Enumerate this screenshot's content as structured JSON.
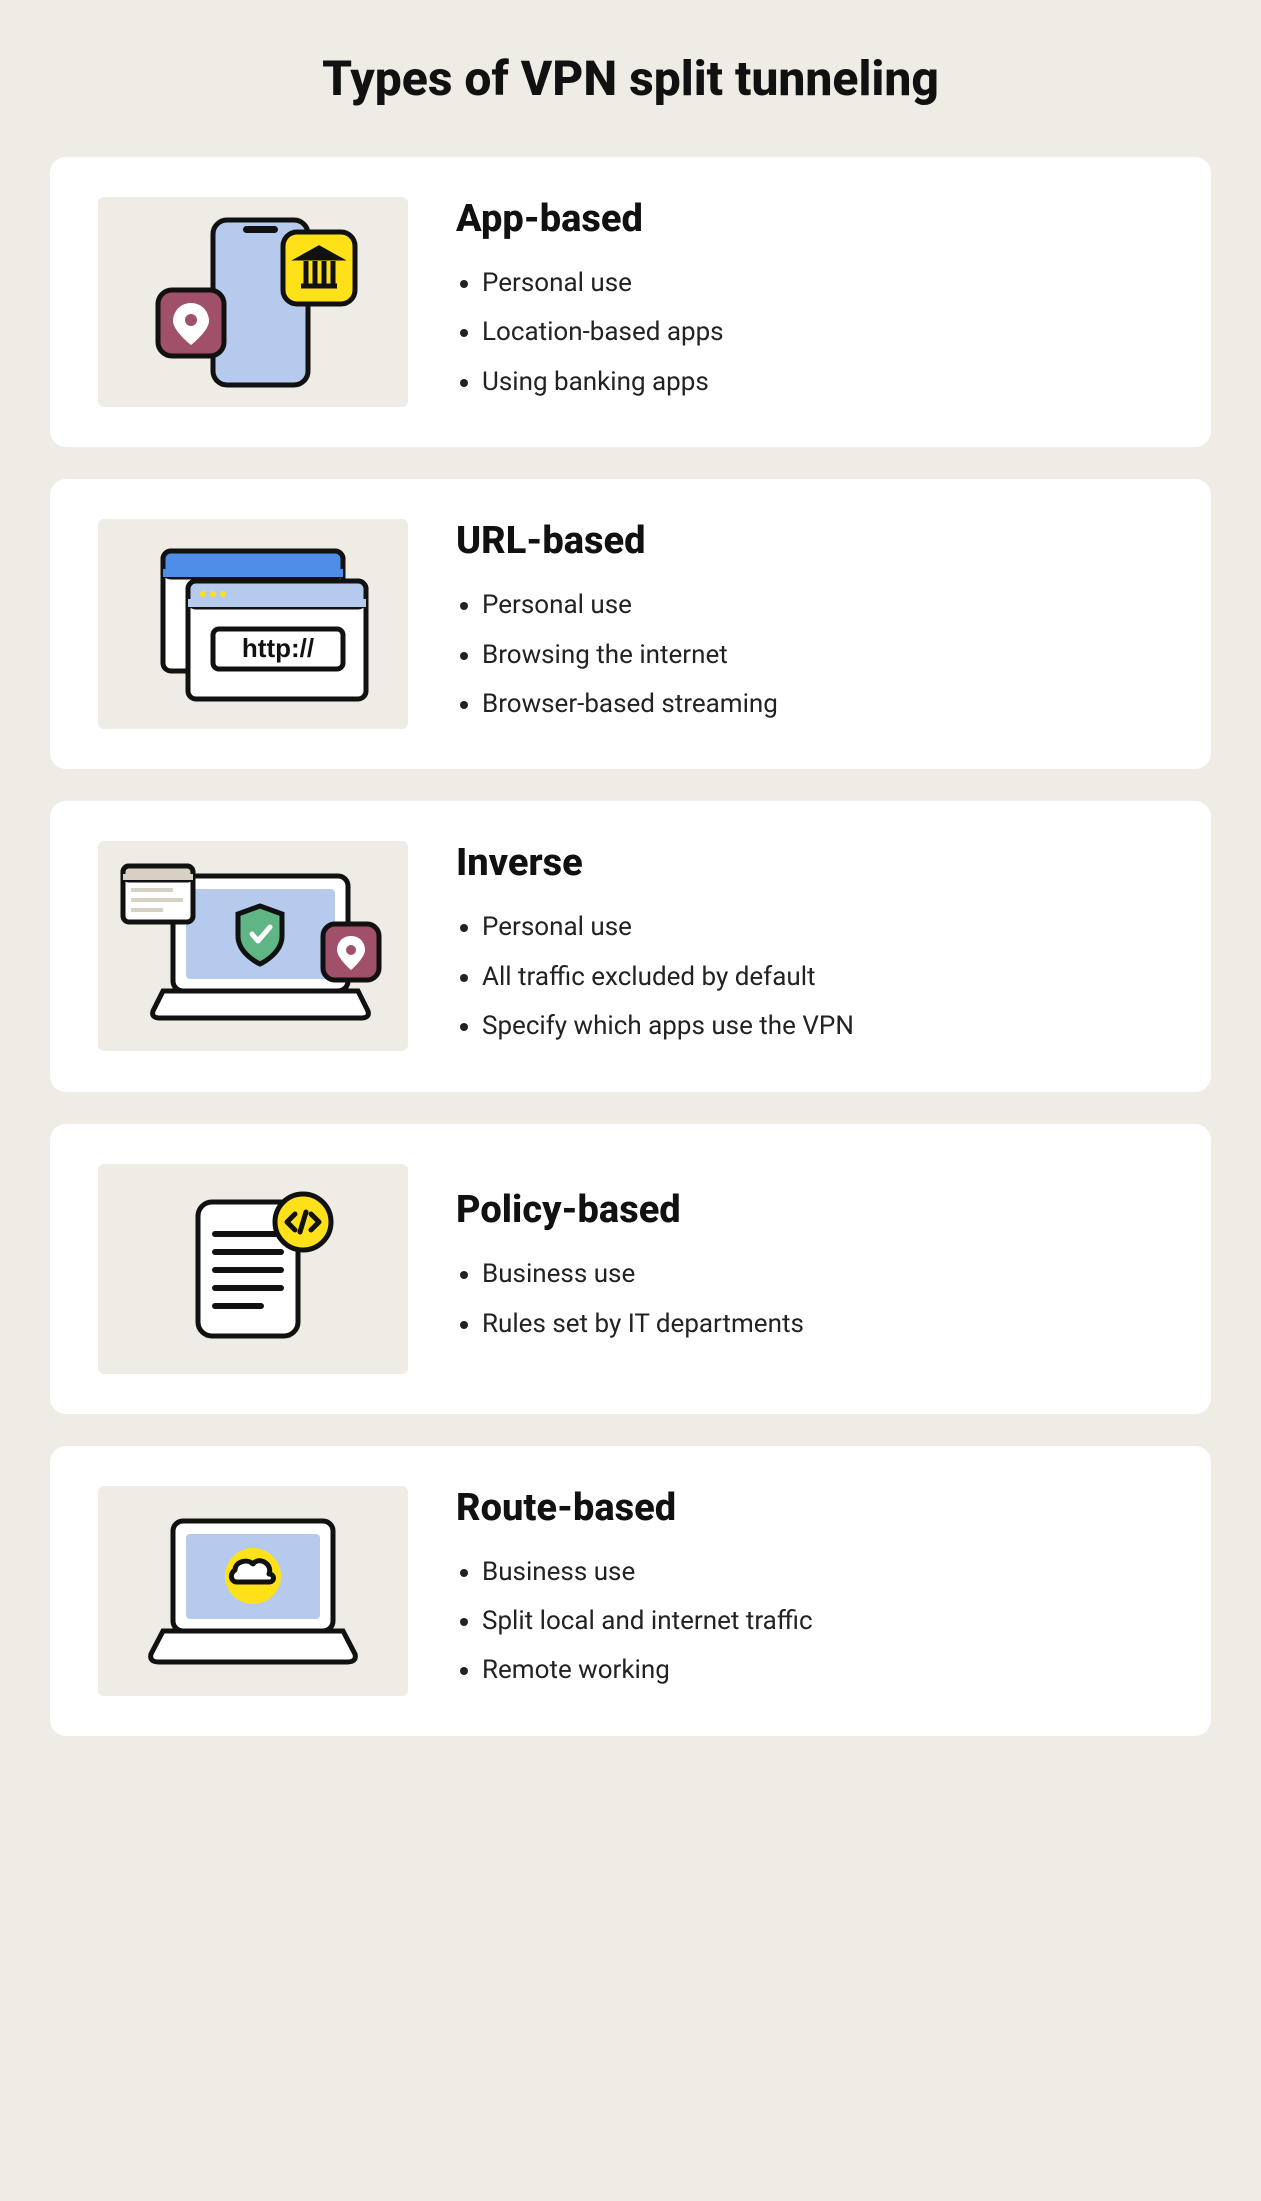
{
  "title": "Types of VPN split tunneling",
  "cards": [
    {
      "heading": "App-based",
      "bullets": [
        "Personal use",
        "Location-based apps",
        "Using banking apps"
      ]
    },
    {
      "heading": "URL-based",
      "bullets": [
        "Personal use",
        "Browsing the internet",
        "Browser-based streaming"
      ]
    },
    {
      "heading": "Inverse",
      "bullets": [
        "Personal use",
        "All traffic excluded by default",
        "Specify which apps use the VPN"
      ]
    },
    {
      "heading": "Policy-based",
      "bullets": [
        "Business use",
        "Rules set by IT departments"
      ]
    },
    {
      "heading": "Route-based",
      "bullets": [
        "Business use",
        "Split local and internet traffic",
        "Remote working"
      ]
    }
  ]
}
